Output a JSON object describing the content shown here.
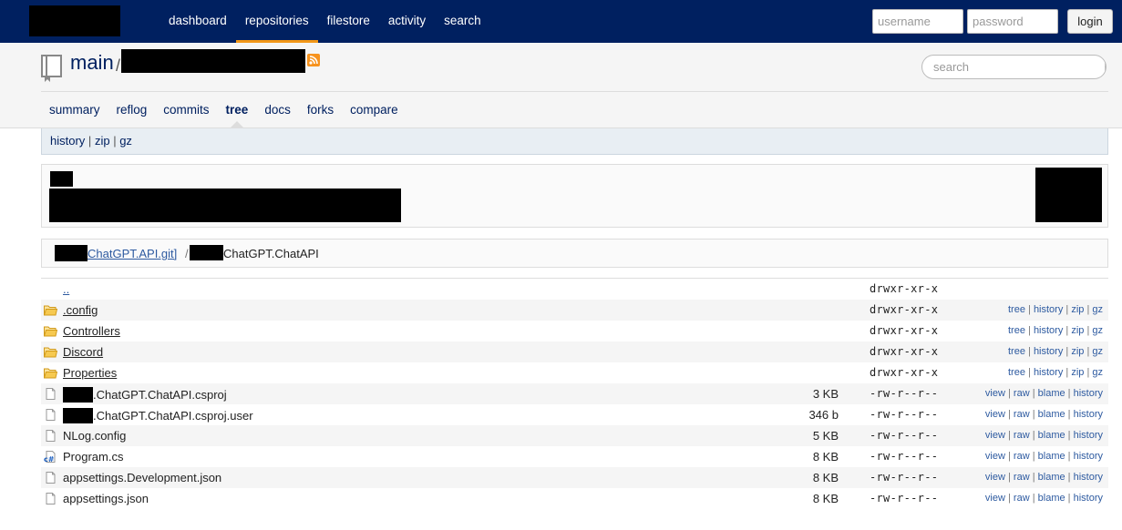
{
  "nav": {
    "items": [
      {
        "label": "dashboard"
      },
      {
        "label": "repositories"
      },
      {
        "label": "filestore"
      },
      {
        "label": "activity"
      },
      {
        "label": "search"
      }
    ],
    "username_placeholder": "username",
    "password_placeholder": "password",
    "login_label": "login"
  },
  "repo": {
    "title": "main",
    "separator": "/",
    "search_placeholder": "search"
  },
  "tabs": [
    {
      "label": "summary"
    },
    {
      "label": "reflog"
    },
    {
      "label": "commits"
    },
    {
      "label": "tree"
    },
    {
      "label": "docs"
    },
    {
      "label": "forks"
    },
    {
      "label": "compare"
    }
  ],
  "subnav": {
    "history": "history",
    "zip": "zip",
    "gz": "gz",
    "sep": "|"
  },
  "breadcrumb": {
    "root": "ChatGPT.API.git]",
    "sep": "/",
    "current": "ChatGPT.ChatAPI"
  },
  "link_sep": "|",
  "folder_links": [
    "tree",
    "history",
    "zip",
    "gz"
  ],
  "file_links": [
    "view",
    "raw",
    "blame",
    "history"
  ],
  "files": [
    {
      "name": "..",
      "size": "",
      "mode": "drwxr-xr-x"
    },
    {
      "name": ".config",
      "size": "",
      "mode": "drwxr-xr-x"
    },
    {
      "name": "Controllers",
      "size": "",
      "mode": "drwxr-xr-x"
    },
    {
      "name": "Discord",
      "size": "",
      "mode": "drwxr-xr-x"
    },
    {
      "name": "Properties",
      "size": "",
      "mode": "drwxr-xr-x"
    },
    {
      "name": ".ChatGPT.ChatAPI.csproj",
      "size": "3 KB",
      "mode": "-rw-r--r--"
    },
    {
      "name": ".ChatGPT.ChatAPI.csproj.user",
      "size": "346 b",
      "mode": "-rw-r--r--"
    },
    {
      "name": "NLog.config",
      "size": "5 KB",
      "mode": "-rw-r--r--"
    },
    {
      "name": "Program.cs",
      "size": "8 KB",
      "mode": "-rw-r--r--"
    },
    {
      "name": "appsettings.Development.json",
      "size": "8 KB",
      "mode": "-rw-r--r--"
    },
    {
      "name": "appsettings.json",
      "size": "8 KB",
      "mode": "-rw-r--r--"
    }
  ],
  "colors": {
    "navbar": "#002060",
    "active_tab_underline": "#f29718",
    "link": "#2d5aa0",
    "folder": "#f0b429"
  },
  "icons": {
    "repo": "repository-book-icon",
    "rss": "rss-feed-icon",
    "search": "magnifier-icon",
    "folder": "folder-icon",
    "file": "file-icon",
    "csharp": "csharp-file-icon"
  }
}
